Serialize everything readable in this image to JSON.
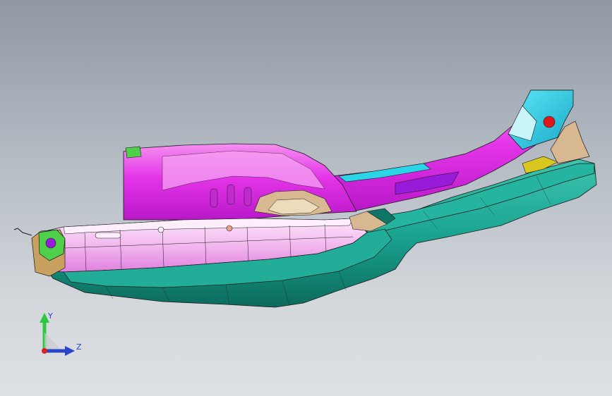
{
  "viewport": {
    "background_top": "#8f98a3",
    "background_bottom": "#dde0e4"
  },
  "model": {
    "colors": {
      "magenta": "#e434e8",
      "magenta_light": "#f2a8f0",
      "teal": "#1aa592",
      "teal_dark": "#0f7566",
      "cyan": "#2cd4e8",
      "pink_white": "#f6d8f4",
      "tan": "#d8b890",
      "green": "#4fd04a",
      "red": "#e01818",
      "purple": "#9a1adc",
      "yellow": "#d8c820",
      "edge": "#1a1a1a"
    }
  },
  "triad": {
    "y_label": "Y",
    "z_label": "Z",
    "y_color": "#2ec840",
    "z_color": "#2a44c8",
    "origin_color": "#e02020"
  }
}
